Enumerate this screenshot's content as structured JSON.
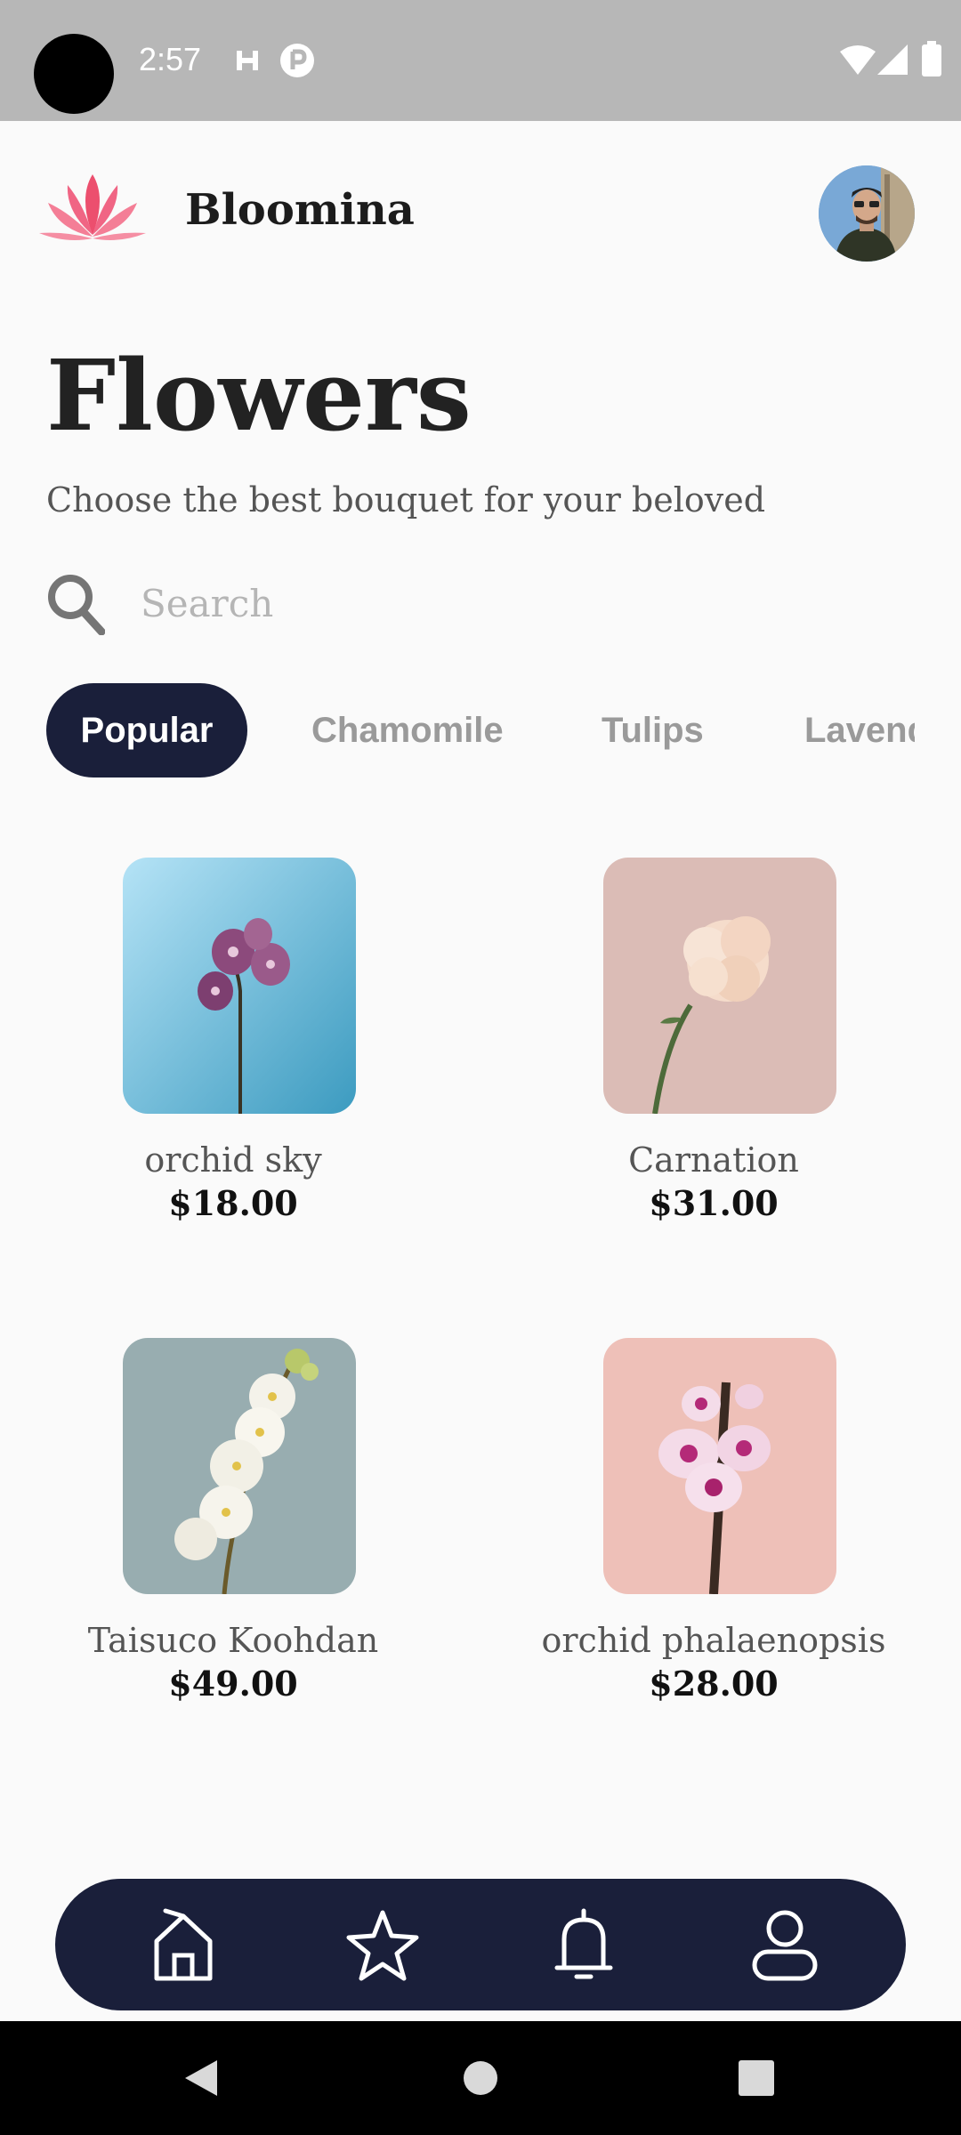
{
  "status_bar": {
    "time": "2:57"
  },
  "header": {
    "app_name": "Bloomina"
  },
  "page": {
    "title": "Flowers",
    "subtitle": "Choose the best bouquet for your beloved"
  },
  "search": {
    "placeholder": "Search",
    "value": ""
  },
  "tabs": [
    {
      "label": "Popular",
      "active": true
    },
    {
      "label": "Chamomile",
      "active": false
    },
    {
      "label": "Tulips",
      "active": false
    },
    {
      "label": "Lavender",
      "active": false
    }
  ],
  "products": [
    {
      "name": "orchid sky",
      "price": "$18.00"
    },
    {
      "name": "Carnation",
      "price": "$31.00"
    },
    {
      "name": "Taisuco Koohdan",
      "price": "$49.00"
    },
    {
      "name": "orchid phalaenopsis",
      "price": "$28.00"
    }
  ],
  "colors": {
    "accent_dark": "#1a1f3a",
    "logo_pink": "#ee5a76",
    "status_bar": "#b7b7b7",
    "background": "#fafafa"
  },
  "bottom_nav": {
    "icons": [
      "home-icon",
      "star-icon",
      "bell-icon",
      "profile-icon"
    ]
  }
}
